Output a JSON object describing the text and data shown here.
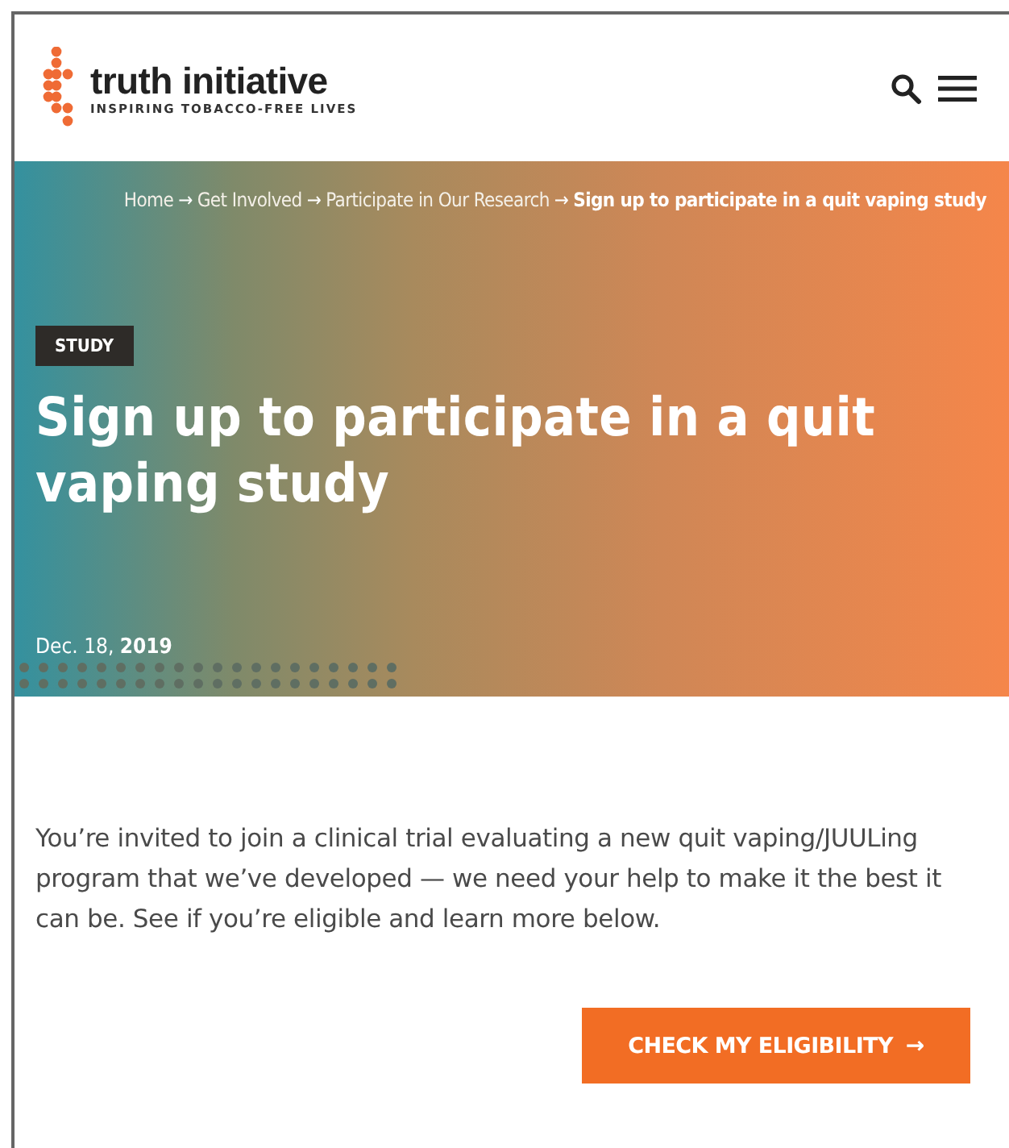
{
  "header": {
    "logo": {
      "name": "truth initiative",
      "tagline": "INSPIRING TOBACCO-FREE LIVES"
    }
  },
  "hero": {
    "breadcrumb": {
      "separator": "→",
      "items": [
        {
          "label": "Home",
          "current": false
        },
        {
          "label": "Get Involved",
          "current": false
        },
        {
          "label": "Participate in Our Research",
          "current": false
        },
        {
          "label": "Sign up to participate in a quit vaping study",
          "current": true
        }
      ]
    },
    "tag": "STUDY",
    "title": "Sign up to participate in a quit vaping study",
    "date": "Dec. 18, **2019**"
  },
  "intro": {
    "text": "You’re invited to join a clinical trial evaluating a new quit vaping/JUULing program that we’ve developed — we need your help to make it the best it can be. See if you’re eligible and learn more below.",
    "button": {
      "label": "CHECK MY ELIGIBILITY",
      "arrow": "→"
    }
  }
}
